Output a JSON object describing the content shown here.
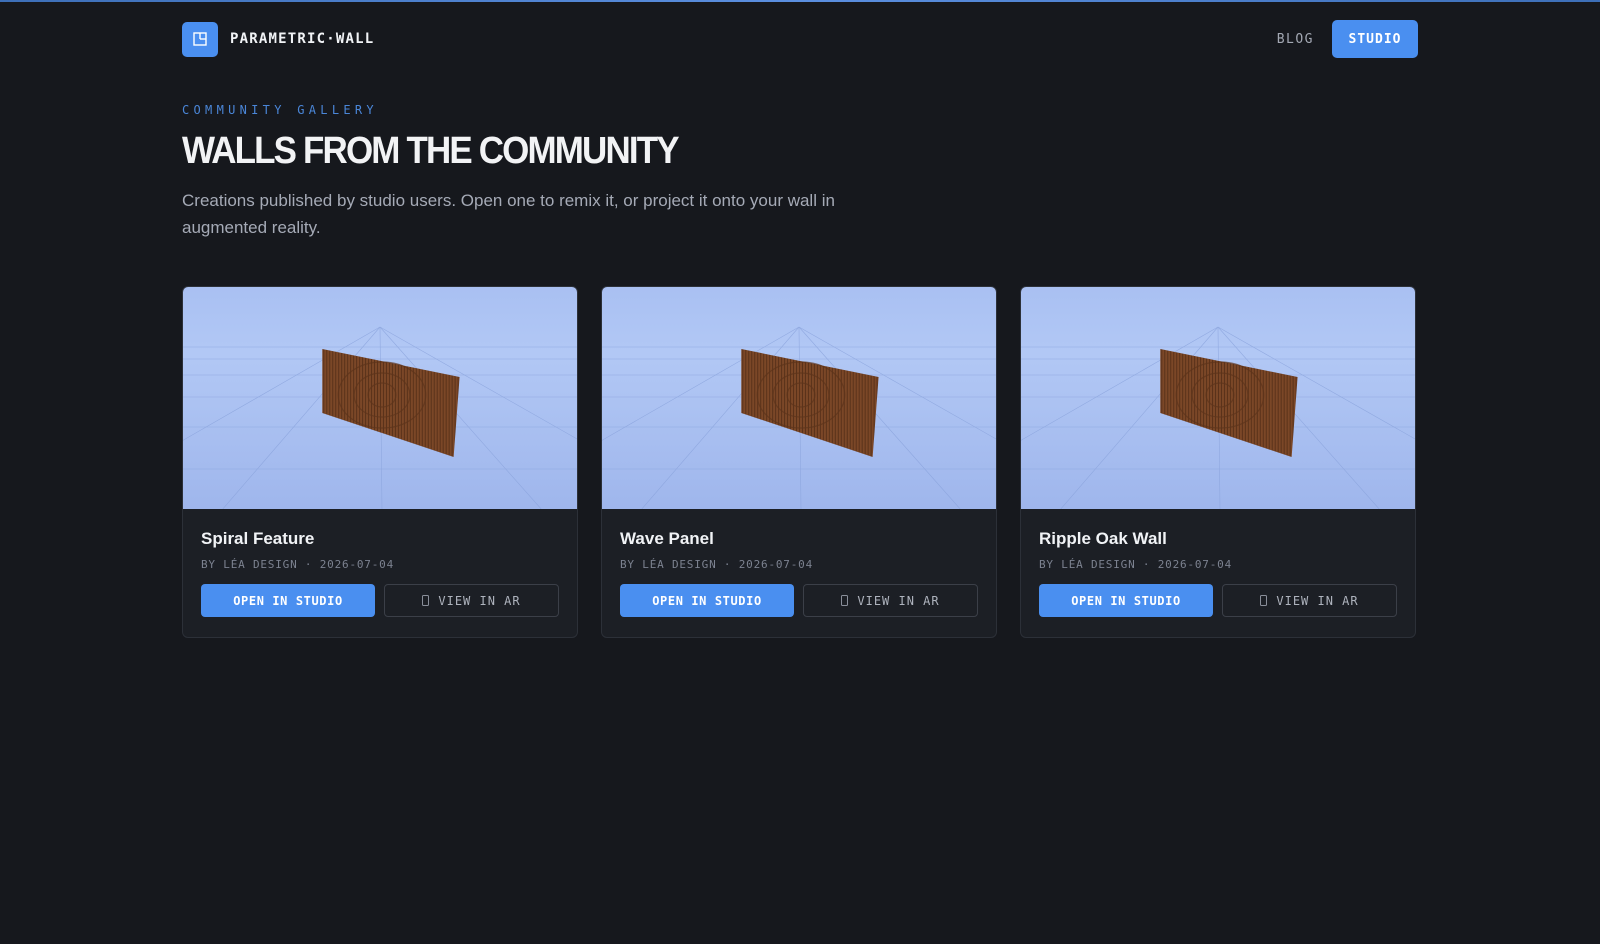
{
  "brand": {
    "name": "PARAMETRIC·WALL",
    "logo_icon": "layout-icon",
    "accent": "#4a8ff0"
  },
  "nav": {
    "blog": "BLOG",
    "studio": "STUDIO"
  },
  "hero": {
    "eyebrow": "COMMUNITY GALLERY",
    "title": "WALLS FROM THE COMMUNITY",
    "description": "Creations published by studio users. Open one to remix it, or project it onto your wall in augmented reality."
  },
  "gallery": [
    {
      "title": "Spiral Feature",
      "meta": "BY LÉA DESIGN · 2026-07-04",
      "open_label": "OPEN IN STUDIO",
      "ar_label": "VIEW IN AR",
      "ar_icon": "phone-icon"
    },
    {
      "title": "Wave Panel",
      "meta": "BY LÉA DESIGN · 2026-07-04",
      "open_label": "OPEN IN STUDIO",
      "ar_label": "VIEW IN AR",
      "ar_icon": "phone-icon"
    },
    {
      "title": "Ripple Oak Wall",
      "meta": "BY LÉA DESIGN · 2026-07-04",
      "open_label": "OPEN IN STUDIO",
      "ar_label": "VIEW IN AR",
      "ar_icon": "phone-icon"
    }
  ],
  "colors": {
    "background": "#16181d",
    "card": "#1c1f25",
    "thumb_sky": "#aec3f3",
    "wood": "#7a4625"
  }
}
